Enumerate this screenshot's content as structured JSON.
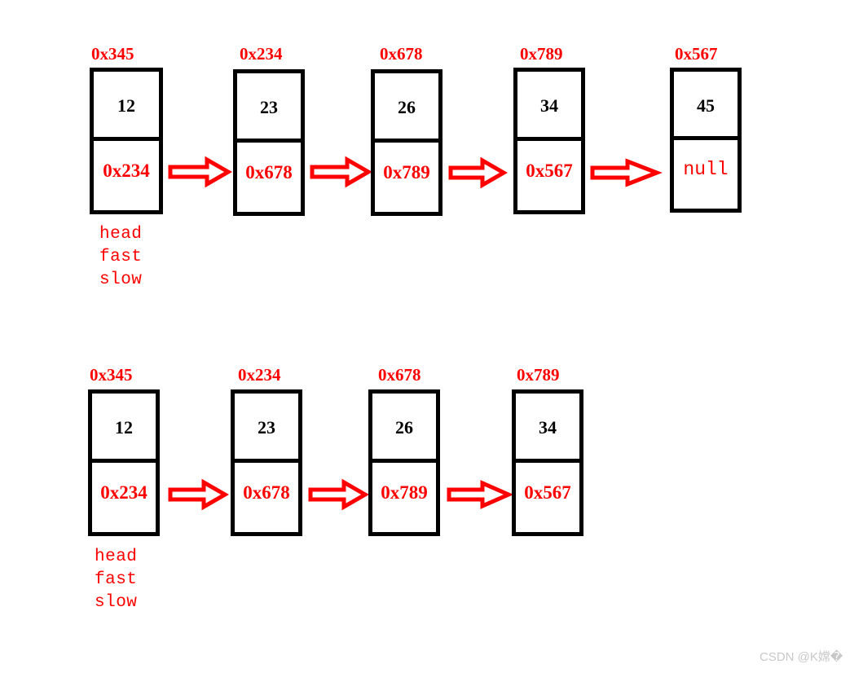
{
  "diagram": {
    "title": "Linked list fast/slow pointer diagram",
    "colors": {
      "box_border": "#000000",
      "value_text": "#000000",
      "pointer_text": "#ff0000",
      "address_label": "#ff0000",
      "arrow": "#ff0000",
      "background": "#ffffff",
      "watermark": "#c8c8c8"
    },
    "rows": [
      {
        "id": "row-1",
        "pointer_names": [
          "head",
          "fast",
          "slow"
        ],
        "nodes": [
          {
            "address": "0x345",
            "value": "12",
            "next": "0x234",
            "next_is_null": false
          },
          {
            "address": "0x234",
            "value": "23",
            "next": "0x678",
            "next_is_null": false
          },
          {
            "address": "0x678",
            "value": "26",
            "next": "0x789",
            "next_is_null": false
          },
          {
            "address": "0x789",
            "value": "34",
            "next": "0x567",
            "next_is_null": false
          },
          {
            "address": "0x567",
            "value": "45",
            "next": "null",
            "next_is_null": true
          }
        ]
      },
      {
        "id": "row-2",
        "pointer_names": [
          "head",
          "fast",
          "slow"
        ],
        "nodes": [
          {
            "address": "0x345",
            "value": "12",
            "next": "0x234",
            "next_is_null": false
          },
          {
            "address": "0x234",
            "value": "23",
            "next": "0x678",
            "next_is_null": false
          },
          {
            "address": "0x678",
            "value": "26",
            "next": "0x789",
            "next_is_null": false
          },
          {
            "address": "0x789",
            "value": "34",
            "next": "0x567",
            "next_is_null": false
          }
        ]
      }
    ]
  },
  "watermark": {
    "text": "CSDN @K嫦�"
  }
}
